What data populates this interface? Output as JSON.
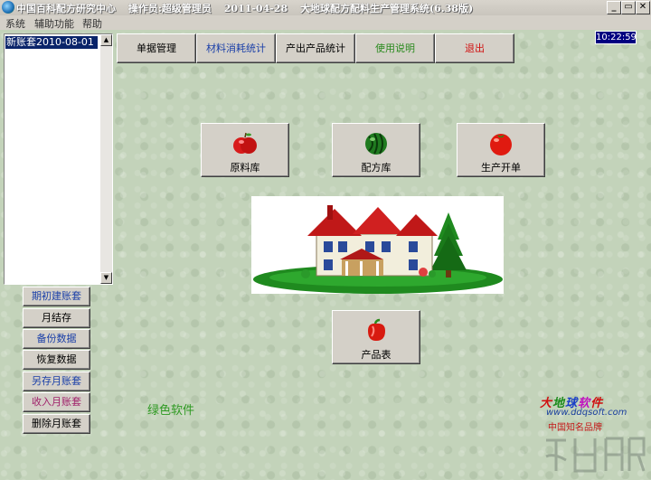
{
  "window": {
    "title_parts": [
      "中国百科配方研究中心",
      "操作员:超级管理员",
      "2011-04-28",
      "大地球配方配料生产管理系统(6.38版)"
    ],
    "controls": {
      "minimize": "_",
      "restore": "▭",
      "close": "✕"
    }
  },
  "menubar": {
    "items": [
      "系统",
      "辅助功能",
      "帮助"
    ]
  },
  "clock": "10:22:59",
  "toolbar": [
    {
      "label": "单据管理",
      "color": "#000000"
    },
    {
      "label": "材料消耗统计",
      "color": "#1a3fa8"
    },
    {
      "label": "产出产品统计",
      "color": "#000000"
    },
    {
      "label": "使用说明",
      "color": "#2a8a1e"
    },
    {
      "label": "退出",
      "color": "#d01010"
    }
  ],
  "account_list": {
    "items": [
      "新账套2010-08-01"
    ],
    "scroll_up": "▲",
    "scroll_down": "▼"
  },
  "left_buttons": [
    {
      "label": "期初建账套",
      "color": "#1a3fa8"
    },
    {
      "label": "月结存",
      "color": "#000000"
    },
    {
      "label": "备份数据",
      "color": "#1a3fa8"
    },
    {
      "label": "恢复数据",
      "color": "#000000"
    },
    {
      "label": "另存月账套",
      "color": "#1a3fa8"
    },
    {
      "label": "收入月账套",
      "color": "#a0206a"
    },
    {
      "label": "删除月账套",
      "color": "#000000"
    }
  ],
  "main_buttons": [
    {
      "label": "原料库",
      "icon": "apple-icon"
    },
    {
      "label": "配方库",
      "icon": "watermelon-icon"
    },
    {
      "label": "生产开单",
      "icon": "tomato-icon"
    }
  ],
  "product_button": {
    "label": "产品表",
    "icon": "pepper-icon"
  },
  "footer_text": "绿色软件",
  "brand": {
    "name_chars": [
      "大",
      "地",
      "球",
      "软",
      "件"
    ],
    "name_colors": [
      "#d01010",
      "#1a8a1a",
      "#1a3fc8",
      "#c010c0",
      "#d01010"
    ],
    "url": "www.ddqsoft.com",
    "slogan": "中国知名品牌"
  }
}
